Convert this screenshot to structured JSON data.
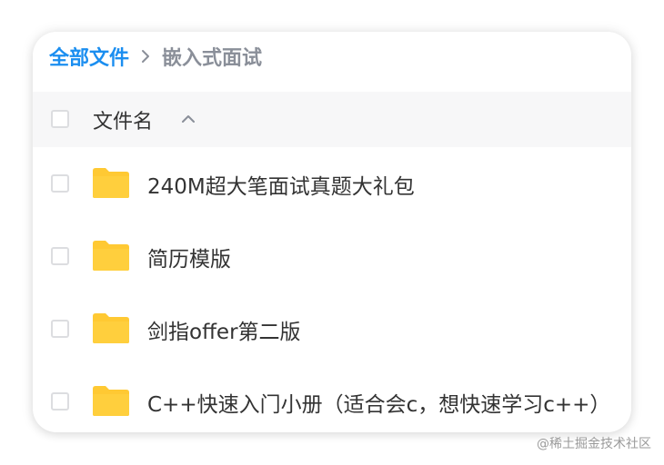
{
  "breadcrumb": {
    "root": "全部文件",
    "current": "嵌入式面试"
  },
  "header": {
    "column_label": "文件名"
  },
  "files": [
    {
      "name": "240M超大笔面试真题大礼包"
    },
    {
      "name": "简历模版"
    },
    {
      "name": "剑指offer第二版"
    },
    {
      "name": "C++快速入门小册（适合会c，想快速学习c++）"
    }
  ],
  "colors": {
    "accent": "#1b8ef0",
    "folder": "#ffc933",
    "header_bg": "#f7f7f8"
  },
  "icons": {
    "separator": "chevron-right-icon",
    "sort": "chevron-up-icon",
    "file": "folder-icon"
  },
  "watermark": "@稀土掘金技术社区"
}
